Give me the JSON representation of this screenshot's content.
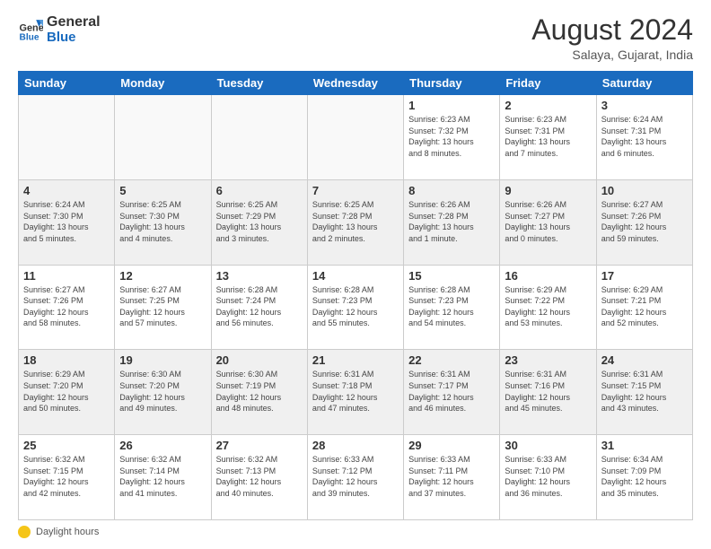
{
  "header": {
    "logo_line1": "General",
    "logo_line2": "Blue",
    "month_year": "August 2024",
    "location": "Salaya, Gujarat, India"
  },
  "days_of_week": [
    "Sunday",
    "Monday",
    "Tuesday",
    "Wednesday",
    "Thursday",
    "Friday",
    "Saturday"
  ],
  "weeks": [
    [
      {
        "day": "",
        "info": ""
      },
      {
        "day": "",
        "info": ""
      },
      {
        "day": "",
        "info": ""
      },
      {
        "day": "",
        "info": ""
      },
      {
        "day": "1",
        "info": "Sunrise: 6:23 AM\nSunset: 7:32 PM\nDaylight: 13 hours\nand 8 minutes."
      },
      {
        "day": "2",
        "info": "Sunrise: 6:23 AM\nSunset: 7:31 PM\nDaylight: 13 hours\nand 7 minutes."
      },
      {
        "day": "3",
        "info": "Sunrise: 6:24 AM\nSunset: 7:31 PM\nDaylight: 13 hours\nand 6 minutes."
      }
    ],
    [
      {
        "day": "4",
        "info": "Sunrise: 6:24 AM\nSunset: 7:30 PM\nDaylight: 13 hours\nand 5 minutes."
      },
      {
        "day": "5",
        "info": "Sunrise: 6:25 AM\nSunset: 7:30 PM\nDaylight: 13 hours\nand 4 minutes."
      },
      {
        "day": "6",
        "info": "Sunrise: 6:25 AM\nSunset: 7:29 PM\nDaylight: 13 hours\nand 3 minutes."
      },
      {
        "day": "7",
        "info": "Sunrise: 6:25 AM\nSunset: 7:28 PM\nDaylight: 13 hours\nand 2 minutes."
      },
      {
        "day": "8",
        "info": "Sunrise: 6:26 AM\nSunset: 7:28 PM\nDaylight: 13 hours\nand 1 minute."
      },
      {
        "day": "9",
        "info": "Sunrise: 6:26 AM\nSunset: 7:27 PM\nDaylight: 13 hours\nand 0 minutes."
      },
      {
        "day": "10",
        "info": "Sunrise: 6:27 AM\nSunset: 7:26 PM\nDaylight: 12 hours\nand 59 minutes."
      }
    ],
    [
      {
        "day": "11",
        "info": "Sunrise: 6:27 AM\nSunset: 7:26 PM\nDaylight: 12 hours\nand 58 minutes."
      },
      {
        "day": "12",
        "info": "Sunrise: 6:27 AM\nSunset: 7:25 PM\nDaylight: 12 hours\nand 57 minutes."
      },
      {
        "day": "13",
        "info": "Sunrise: 6:28 AM\nSunset: 7:24 PM\nDaylight: 12 hours\nand 56 minutes."
      },
      {
        "day": "14",
        "info": "Sunrise: 6:28 AM\nSunset: 7:23 PM\nDaylight: 12 hours\nand 55 minutes."
      },
      {
        "day": "15",
        "info": "Sunrise: 6:28 AM\nSunset: 7:23 PM\nDaylight: 12 hours\nand 54 minutes."
      },
      {
        "day": "16",
        "info": "Sunrise: 6:29 AM\nSunset: 7:22 PM\nDaylight: 12 hours\nand 53 minutes."
      },
      {
        "day": "17",
        "info": "Sunrise: 6:29 AM\nSunset: 7:21 PM\nDaylight: 12 hours\nand 52 minutes."
      }
    ],
    [
      {
        "day": "18",
        "info": "Sunrise: 6:29 AM\nSunset: 7:20 PM\nDaylight: 12 hours\nand 50 minutes."
      },
      {
        "day": "19",
        "info": "Sunrise: 6:30 AM\nSunset: 7:20 PM\nDaylight: 12 hours\nand 49 minutes."
      },
      {
        "day": "20",
        "info": "Sunrise: 6:30 AM\nSunset: 7:19 PM\nDaylight: 12 hours\nand 48 minutes."
      },
      {
        "day": "21",
        "info": "Sunrise: 6:31 AM\nSunset: 7:18 PM\nDaylight: 12 hours\nand 47 minutes."
      },
      {
        "day": "22",
        "info": "Sunrise: 6:31 AM\nSunset: 7:17 PM\nDaylight: 12 hours\nand 46 minutes."
      },
      {
        "day": "23",
        "info": "Sunrise: 6:31 AM\nSunset: 7:16 PM\nDaylight: 12 hours\nand 45 minutes."
      },
      {
        "day": "24",
        "info": "Sunrise: 6:31 AM\nSunset: 7:15 PM\nDaylight: 12 hours\nand 43 minutes."
      }
    ],
    [
      {
        "day": "25",
        "info": "Sunrise: 6:32 AM\nSunset: 7:15 PM\nDaylight: 12 hours\nand 42 minutes."
      },
      {
        "day": "26",
        "info": "Sunrise: 6:32 AM\nSunset: 7:14 PM\nDaylight: 12 hours\nand 41 minutes."
      },
      {
        "day": "27",
        "info": "Sunrise: 6:32 AM\nSunset: 7:13 PM\nDaylight: 12 hours\nand 40 minutes."
      },
      {
        "day": "28",
        "info": "Sunrise: 6:33 AM\nSunset: 7:12 PM\nDaylight: 12 hours\nand 39 minutes."
      },
      {
        "day": "29",
        "info": "Sunrise: 6:33 AM\nSunset: 7:11 PM\nDaylight: 12 hours\nand 37 minutes."
      },
      {
        "day": "30",
        "info": "Sunrise: 6:33 AM\nSunset: 7:10 PM\nDaylight: 12 hours\nand 36 minutes."
      },
      {
        "day": "31",
        "info": "Sunrise: 6:34 AM\nSunset: 7:09 PM\nDaylight: 12 hours\nand 35 minutes."
      }
    ]
  ],
  "footer": {
    "daylight_label": "Daylight hours"
  }
}
